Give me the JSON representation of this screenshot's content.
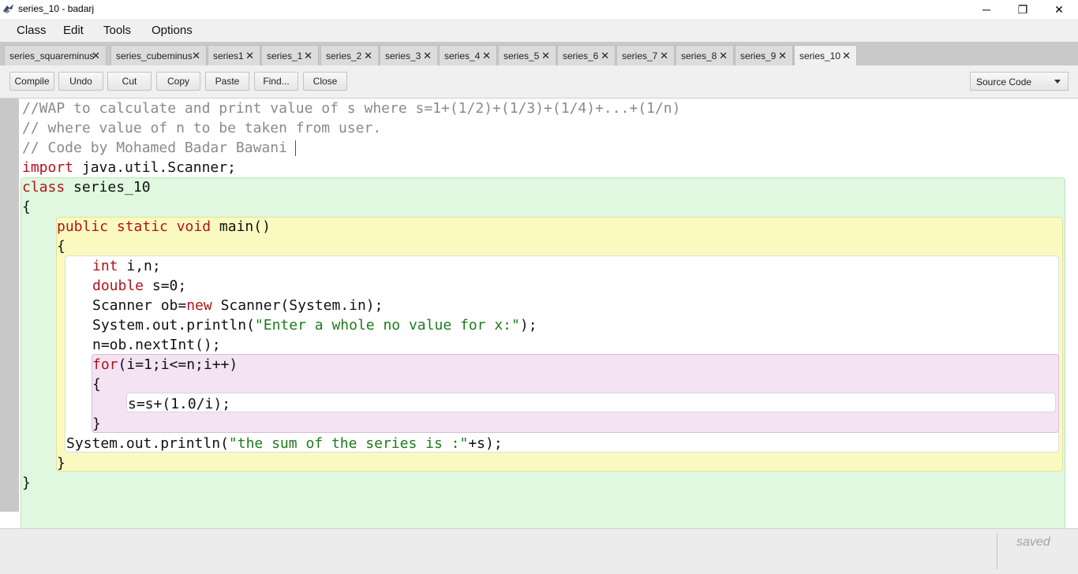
{
  "window": {
    "title": "series_10 - badarj",
    "controls": {
      "minimize": "─",
      "maximize": "❐",
      "close": "✕"
    }
  },
  "menu": [
    "Class",
    "Edit",
    "Tools",
    "Options"
  ],
  "tabs": [
    {
      "label": "series_squareminus",
      "active": false
    },
    {
      "label": "series_cubeminus",
      "active": false
    },
    {
      "label": "series1",
      "active": false
    },
    {
      "label": "series_1",
      "active": false
    },
    {
      "label": "series_2",
      "active": false
    },
    {
      "label": "series_3",
      "active": false
    },
    {
      "label": "series_4",
      "active": false
    },
    {
      "label": "series_5",
      "active": false
    },
    {
      "label": "series_6",
      "active": false
    },
    {
      "label": "series_7",
      "active": false
    },
    {
      "label": "series_8",
      "active": false
    },
    {
      "label": "series_9",
      "active": false
    },
    {
      "label": "series_10",
      "active": true
    }
  ],
  "tab_close_glyph": "✕",
  "toolbar": [
    "Compile",
    "Undo",
    "Cut",
    "Copy",
    "Paste",
    "Find...",
    "Close"
  ],
  "view_selector": {
    "selected": "Source Code"
  },
  "editor": {
    "lines": [
      [
        [
          "//WAP to calculate and print value of s where s=1+(1/2)+(1/3)+(1/4)+...+(1/n)",
          "cmt"
        ]
      ],
      [
        [
          "// where value of n to be taken from user.",
          "cmt"
        ]
      ],
      [
        [
          "// Code by Mohamed Badar Bawani",
          "cmt"
        ]
      ],
      [
        [
          "import",
          "kw"
        ],
        [
          " java.util.Scanner;",
          ""
        ]
      ],
      [
        [
          "class",
          "kw"
        ],
        [
          " series_10",
          ""
        ]
      ],
      [
        [
          "{",
          ""
        ]
      ],
      [
        [
          "public static void",
          "kw"
        ],
        [
          " main()",
          ""
        ]
      ],
      [
        [
          "{",
          ""
        ]
      ],
      [
        [
          "int",
          "kw"
        ],
        [
          " i,n;",
          ""
        ]
      ],
      [
        [
          "double",
          "kw"
        ],
        [
          " s=0;",
          ""
        ]
      ],
      [
        [
          "Scanner ob=",
          ""
        ],
        [
          "new",
          "kw"
        ],
        [
          " Scanner(System.in);",
          ""
        ]
      ],
      [
        [
          "System.out.println(",
          ""
        ],
        [
          "\"Enter a whole no value for x:\"",
          "str"
        ],
        [
          ");",
          ""
        ]
      ],
      [
        [
          "n=ob.nextInt();",
          ""
        ]
      ],
      [
        [
          "for",
          "kw"
        ],
        [
          "(i=1;i<=n;i++)",
          ""
        ]
      ],
      [
        [
          "{",
          ""
        ]
      ],
      [
        [
          "s=s+(1.0/i);",
          ""
        ]
      ],
      [
        [
          "}",
          ""
        ]
      ],
      [
        [
          "System.out.println(",
          ""
        ],
        [
          "\"the sum of the series is :\"",
          "str"
        ],
        [
          "+s);",
          ""
        ]
      ],
      [
        [
          "}",
          ""
        ]
      ],
      [
        [
          "}",
          ""
        ]
      ]
    ]
  },
  "status": {
    "text": "saved"
  }
}
